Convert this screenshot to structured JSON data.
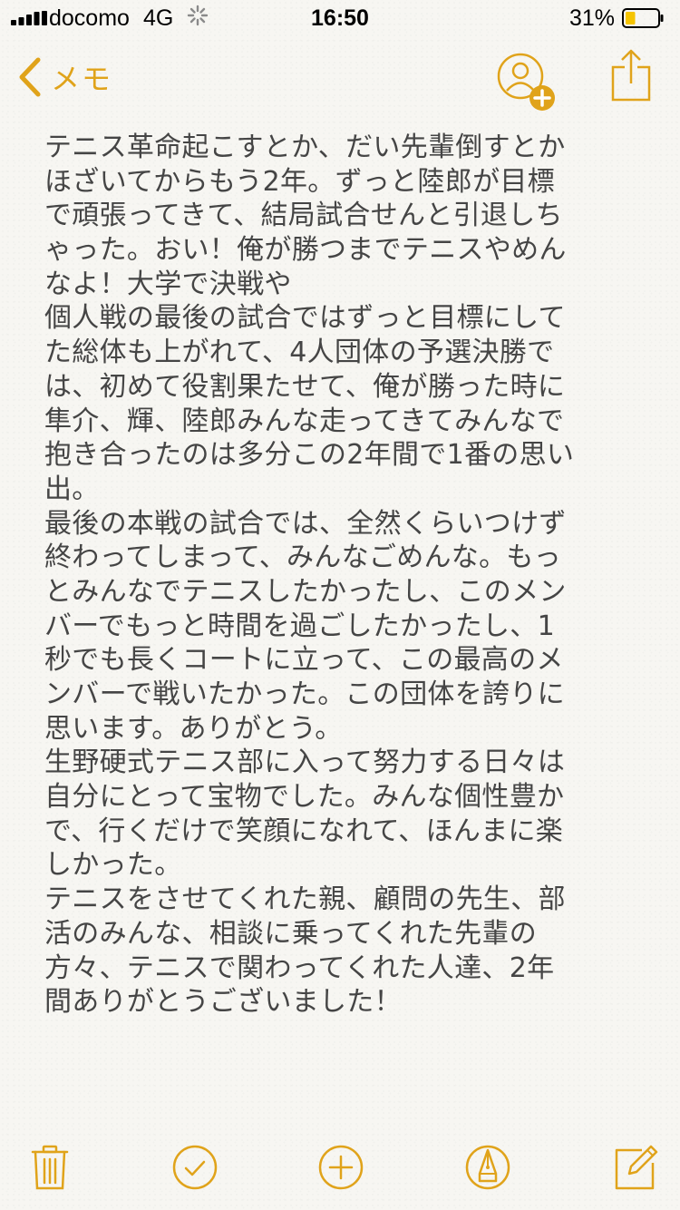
{
  "status_bar": {
    "carrier": "docomo",
    "network": "4G",
    "time": "16:50",
    "battery_percent": "31%",
    "battery_level": 0.31
  },
  "nav": {
    "back_label": "メモ",
    "accent_color": "#e0a31a"
  },
  "note": {
    "lines": [
      "テニス革命起こすとか、だい先輩倒すとか",
      "ほざいてからもう2年。ずっと陸郎が目標",
      "で頑張ってきて、結局試合せんと引退しち",
      "ゃった。おい！俺が勝つまでテニスやめん",
      "なよ！大学で決戦や",
      "個人戦の最後の試合ではずっと目標にして",
      "た総体も上がれて、4人団体の予選決勝で",
      "は、初めて役割果たせて、俺が勝った時に",
      "隼介、輝、陸郎みんな走ってきてみんなで",
      "抱き合ったのは多分この2年間で1番の思い",
      "出。",
      "最後の本戦の試合では、全然くらいつけず",
      "終わってしまって、みんなごめんな。もっ",
      "とみんなでテニスしたかったし、このメン",
      "バーでもっと時間を過ごしたかったし、1",
      "秒でも長くコートに立って、この最高のメ",
      "ンバーで戦いたかった。この団体を誇りに",
      "思います。ありがとう。",
      "生野硬式テニス部に入って努力する日々は",
      "自分にとって宝物でした。みんな個性豊か",
      "で、行くだけで笑顔になれて、ほんまに楽",
      "しかった。",
      "テニスをさせてくれた親、顧問の先生、部",
      "活のみんな、相談に乗ってくれた先輩の",
      "方々、テニスで関わってくれた人達、2年",
      "間ありがとうございました！"
    ]
  },
  "toolbar": {
    "icons": [
      "trash-icon",
      "checklist-icon",
      "add-icon",
      "sketch-icon",
      "compose-icon"
    ]
  }
}
